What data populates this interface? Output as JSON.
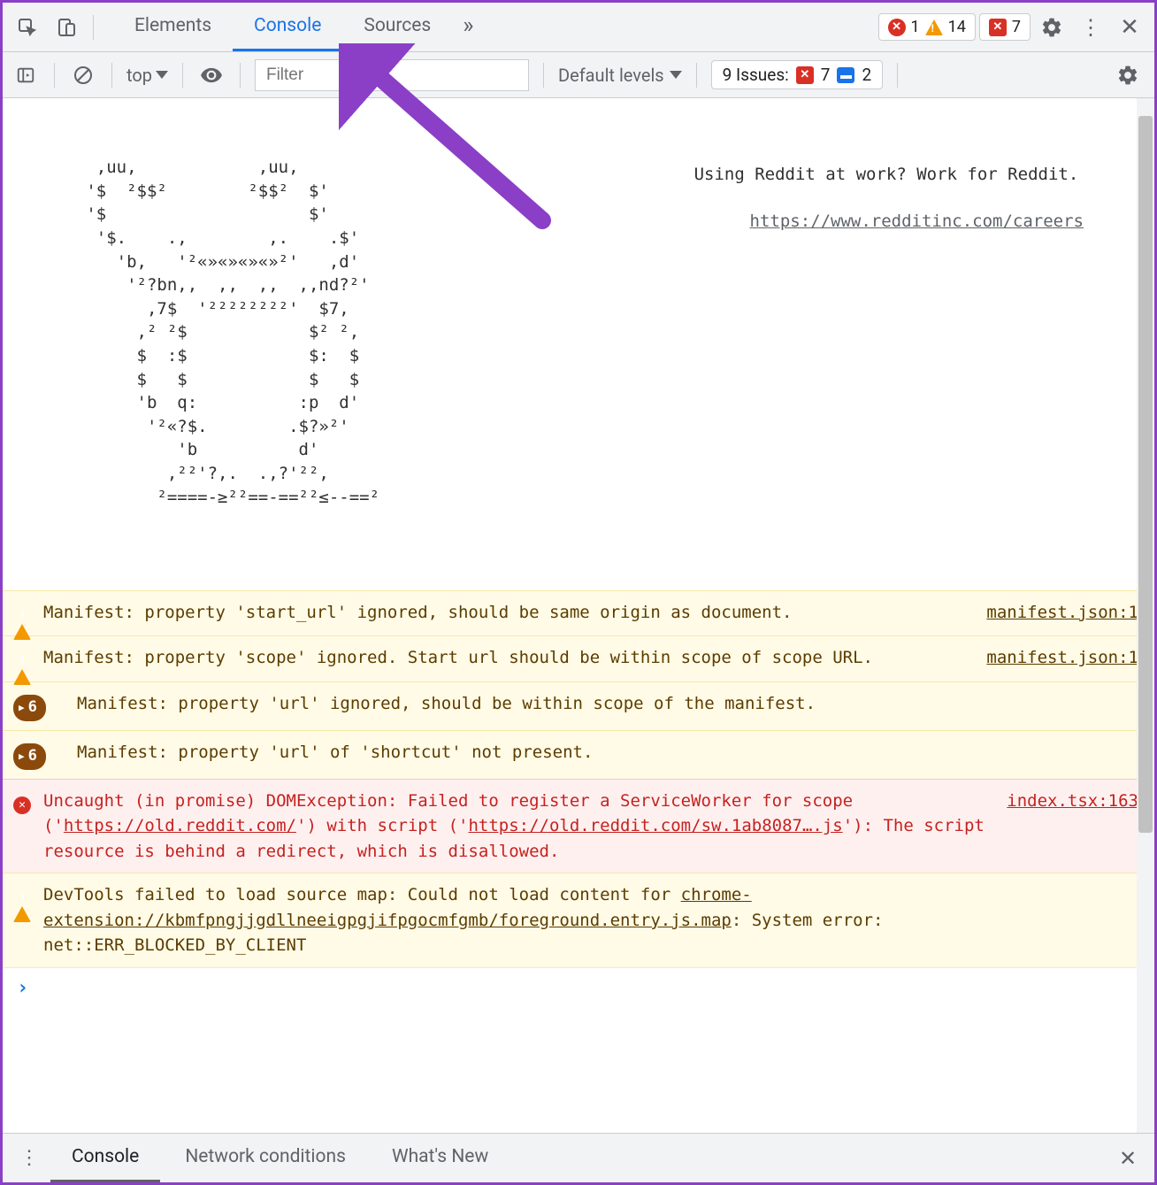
{
  "topTabs": {
    "elements": "Elements",
    "console": "Console",
    "sources": "Sources"
  },
  "topCounts": {
    "errors": "1",
    "warnings": "14",
    "messages": "7"
  },
  "subToolbar": {
    "context": "top",
    "filterPlaceholder": "Filter",
    "levels": "Default levels",
    "issuesLabel": "9 Issues:",
    "issuesErr": "7",
    "issuesMsg": "2"
  },
  "ascii": "    ,uu,            ,uu,\n   '$  ²$$²        ²$$²  $'\n   '$                    $'\n    '$.    .,        ,.    .$'\n      'b,   '²«»«»«»«»²'   ,d'\n       '²?bn,,  ,,  ,,  ,,nd?²'\n         ,7$  '²²²²²²²²'  $7,\n        ,² ²$            $² ²,\n        $  :$            $:  $\n        $   $            $   $\n        'b  q:          :p  d'\n         '²«?$.        .$?»²'\n            'b          d'\n           ,²²'?,.  .,?'²²,\n          ²====-≥²²==-==²²≤--==²",
  "redditMsg": {
    "line1": "Using Reddit at work? Work for Reddit.",
    "link": "https://www.redditinc.com/careers"
  },
  "logs": [
    {
      "type": "warn",
      "badge": null,
      "text": "Manifest: property 'start_url' ignored, should be same origin as document.",
      "src": "manifest.json:1"
    },
    {
      "type": "warn",
      "badge": null,
      "text": "Manifest: property 'scope' ignored. Start url should be within scope of scope URL.",
      "src": "manifest.json:1"
    },
    {
      "type": "warn",
      "badge": "6",
      "text": "Manifest: property 'url' ignored, should be within scope of the manifest.",
      "src": null
    },
    {
      "type": "warn",
      "badge": "6",
      "text": "Manifest: property 'url' of 'shortcut' not present.",
      "src": null
    },
    {
      "type": "error",
      "badge": null,
      "pre": "Uncaught (in promise) DOMException: Failed to register a ServiceWorker for scope ('",
      "link1": "https://old.reddit.com/",
      "mid": "') with script ('",
      "link2": "https://old.reddit.com/sw.1ab8087….js",
      "post": "'): The script resource is behind a redirect, which is disallowed.",
      "src": "index.tsx:163"
    },
    {
      "type": "warn",
      "badge": null,
      "pre": "DevTools failed to load source map: Could not load content for ",
      "link1": "chrome-extension://kbmfpngjjgdllneeigpgjifpgocmfgmb/foreground.entry.js.map",
      "post": ": System error: net::ERR_BLOCKED_BY_CLIENT",
      "src": null
    }
  ],
  "drawerTabs": {
    "console": "Console",
    "network": "Network conditions",
    "whatsnew": "What's New"
  }
}
